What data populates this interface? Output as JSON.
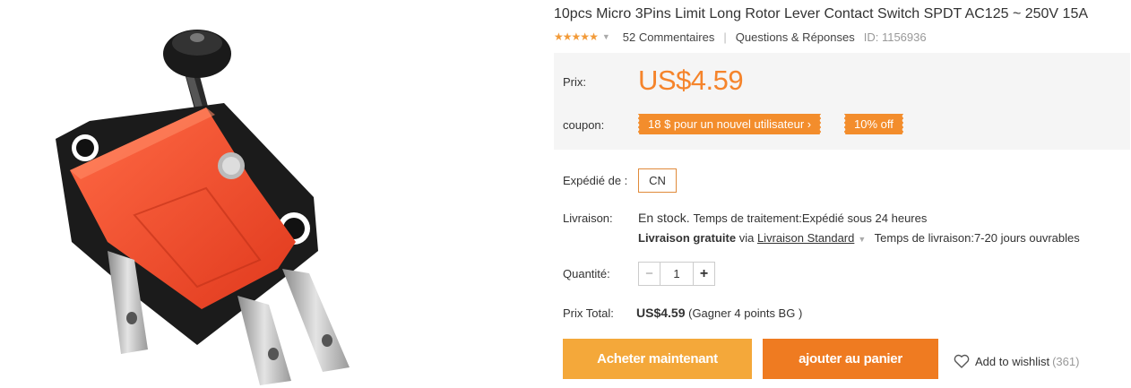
{
  "product": {
    "title": "10pcs Micro 3Pins Limit Long Rotor Lever Contact Switch SPDT AC125 ~ 250V 15A",
    "rating_stars": 5,
    "reviews_label": "52 Commentaires",
    "qa_label": "Questions & Réponses",
    "id_label": "ID: 1156936",
    "image_icon": "limit-switch-photo"
  },
  "price_box": {
    "price_label": "Prix:",
    "price": "US$4.59",
    "coupon_label": "coupon:",
    "coupon_new_user": "18 $ pour un nouvel utilisateur ›",
    "coupon_discount": "10% off"
  },
  "shipping": {
    "shipped_from_label": "Expédié de :",
    "origin": "CN",
    "delivery_label": "Livraison:",
    "stock": "En stock.",
    "processing": "Temps de traitement:Expédié sous 24 heures",
    "free_shipping": "Livraison gratuite",
    "via": "via",
    "method": "Livraison Standard",
    "delivery_time": "Temps de livraison:7-20 jours ouvrables"
  },
  "quantity": {
    "label": "Quantité:",
    "minus": "−",
    "value": "1",
    "plus": "+"
  },
  "total": {
    "label": "Prix Total:",
    "amount": "US$4.59",
    "points": "(Gagner 4 points BG )"
  },
  "actions": {
    "buy_now": "Acheter maintenant",
    "add_to_cart": "ajouter au panier",
    "wishlist": "Add to wishlist",
    "wishlist_count": "(361)"
  },
  "colors": {
    "accent": "#f5842b",
    "buy_button": "#f4a83a",
    "cart_button": "#ef7b21",
    "coupon_bg": "#f38d2c",
    "price_box_bg": "#f5f5f5"
  }
}
